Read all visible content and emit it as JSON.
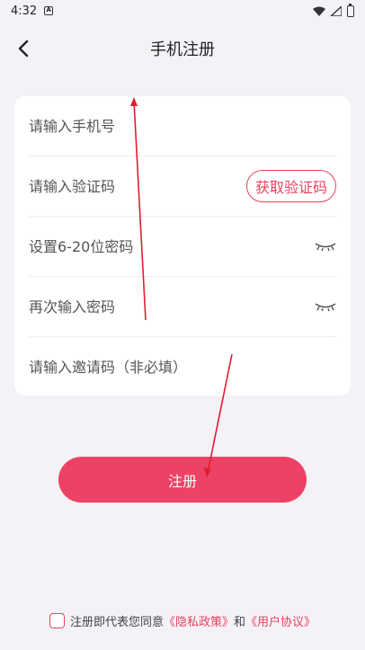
{
  "status_bar": {
    "time": "4:32",
    "notification_glyph": "A"
  },
  "header": {
    "title": "手机注册",
    "back_icon": "chevron-left-icon"
  },
  "form": {
    "phone_placeholder": "请输入手机号",
    "code_placeholder": "请输入验证码",
    "get_code_label": "获取验证码",
    "password_placeholder": "设置6-20位密码",
    "confirm_placeholder": "再次输入密码",
    "invite_placeholder": "请输入邀请码（非必填）"
  },
  "register_label": "注册",
  "agreement": {
    "prefix": "注册即代表您同意",
    "privacy_link": "《隐私政策》",
    "conjunction": "和",
    "user_link": "《用户协议》"
  },
  "colors": {
    "accent": "#ed4265",
    "background": "#f4f2f7"
  }
}
